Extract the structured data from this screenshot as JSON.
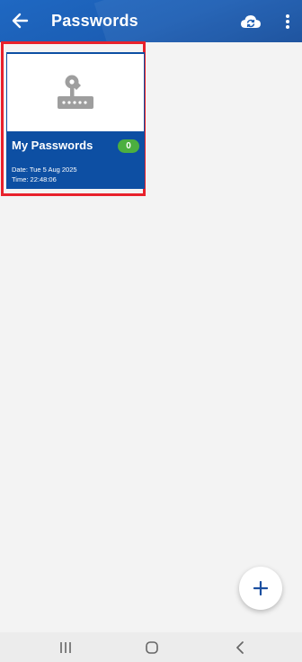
{
  "header": {
    "title": "Passwords",
    "back_icon": "arrow-left-icon",
    "sync_icon": "cloud-sync-icon",
    "menu_icon": "more-vertical-icon"
  },
  "cards": [
    {
      "title": "My Passwords",
      "count": "0",
      "date_line": "Date: Tue 5 Aug 2025",
      "time_line": "Time:  22:48:06",
      "image_icon": "password-key-icon"
    }
  ],
  "fab": {
    "icon": "add-icon"
  },
  "system_nav": {
    "recents_icon": "recents-icon",
    "home_icon": "home-icon",
    "back_icon": "back-icon"
  },
  "colors": {
    "appbar": "#1b5db3",
    "card": "#0d4fa3",
    "badge": "#4caf3f",
    "highlight": "#e8212b",
    "accent": "#1b4fa0"
  }
}
